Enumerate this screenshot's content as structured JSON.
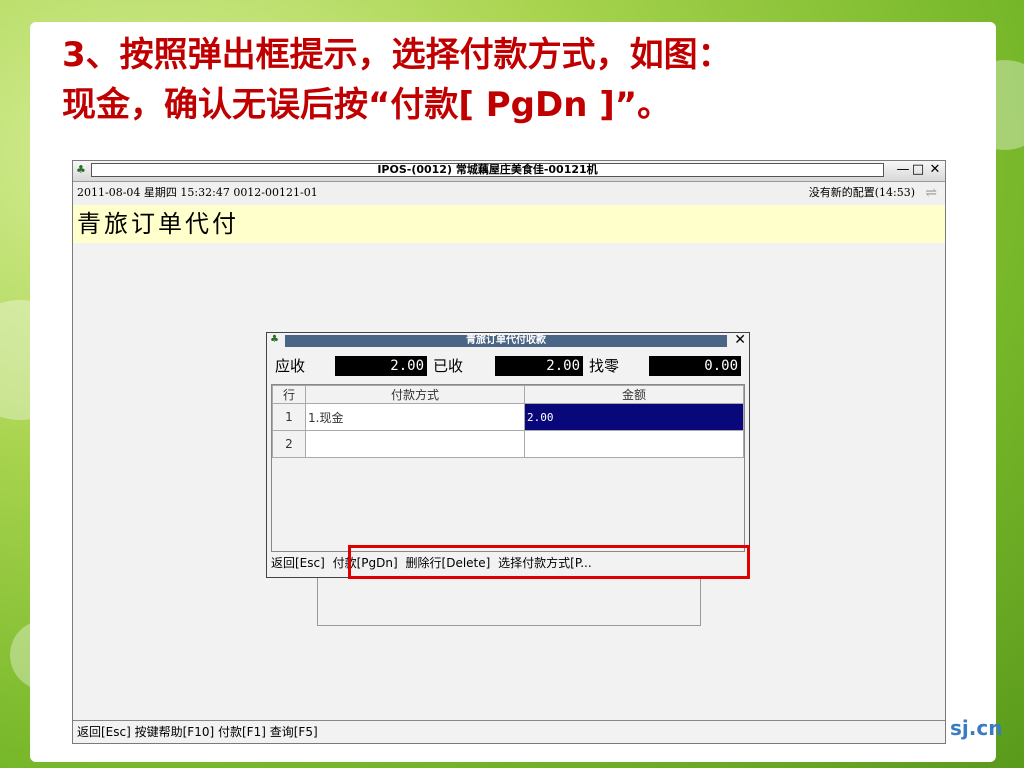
{
  "slide": {
    "heading_line1": "3、按照弹出框提示，选择付款方式，如图：",
    "heading_line2": "现金，确认无误后按“付款[ PgDn ]”。",
    "site_logo": "sj.cn"
  },
  "window": {
    "title": "IPOS-(0012) 常城藕屋庄美食佳-00121机",
    "minimize_glyph": "—",
    "maximize_glyph": "□",
    "close_glyph": "✕"
  },
  "status_top": {
    "datetime_info": "2011-08-04 星期四 15:32:47 0012-00121-01",
    "config_status": "没有新的配置(14:53)"
  },
  "module": {
    "title": "青旅订单代付"
  },
  "dialog": {
    "title": "青旅订单代付收款",
    "receivable_label": "应收",
    "receivable_value": "2.00",
    "received_label": "已收",
    "received_value": "2.00",
    "change_label": "找零",
    "change_value": "0.00",
    "columns": {
      "row": "行",
      "method": "付款方式",
      "amount": "金额"
    },
    "rows": [
      {
        "num": "1",
        "method": "1.现金",
        "amount": "2.00"
      },
      {
        "num": "2",
        "method": "",
        "amount": ""
      }
    ],
    "actions": {
      "back": "返回[Esc]",
      "pay": "付款[PgDn]",
      "delete_row": "删除行[Delete]",
      "choose_method": "选择付款方式[P..."
    }
  },
  "footer": {
    "back": "返回[Esc]",
    "help": "按键帮助[F10]",
    "pay": "付款[F1]",
    "query": "查询[F5]"
  },
  "colors": {
    "heading": "#c00000",
    "highlight": "#e00000",
    "selected_cell": "#08087a",
    "dialog_title_bg": "#4a6585",
    "module_title_bg": "#ffffcc"
  }
}
